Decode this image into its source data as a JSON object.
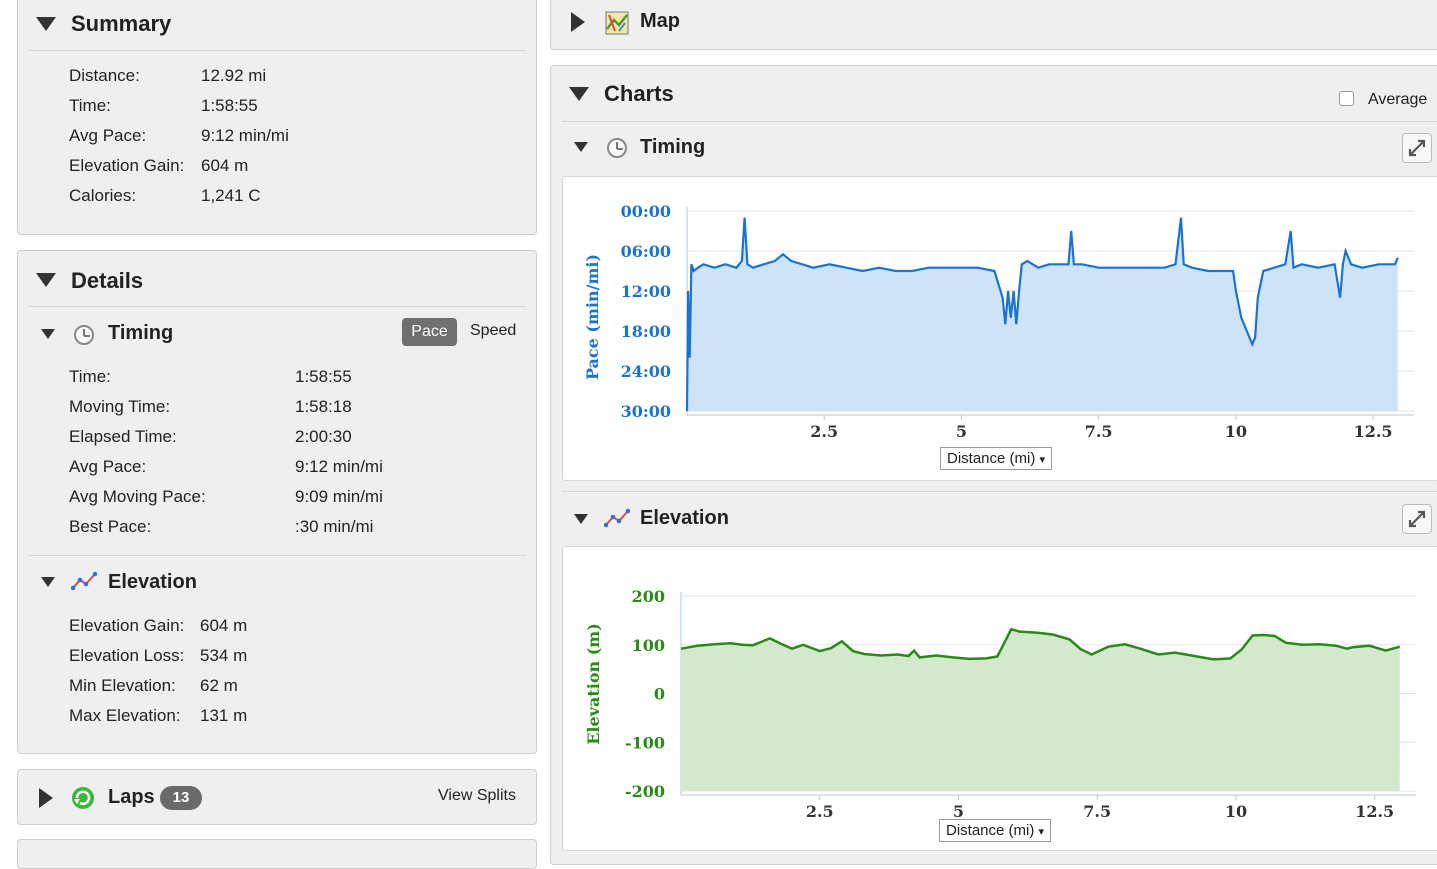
{
  "summary": {
    "title": "Summary",
    "rows": [
      {
        "label": "Distance:",
        "value": "12.92 mi"
      },
      {
        "label": "Time:",
        "value": "1:58:55"
      },
      {
        "label": "Avg Pace:",
        "value": "9:12 min/mi"
      },
      {
        "label": "Elevation Gain:",
        "value": "604 m"
      },
      {
        "label": "Calories:",
        "value": "1,241 C"
      }
    ]
  },
  "details": {
    "title": "Details",
    "timing": {
      "title": "Timing",
      "toggle": {
        "pace": "Pace",
        "speed": "Speed",
        "selected": "Pace"
      },
      "rows": [
        {
          "label": "Time:",
          "value": "1:58:55"
        },
        {
          "label": "Moving Time:",
          "value": "1:58:18"
        },
        {
          "label": "Elapsed Time:",
          "value": "2:00:30"
        },
        {
          "label": "Avg Pace:",
          "value": "9:12 min/mi"
        },
        {
          "label": "Avg Moving Pace:",
          "value": "9:09 min/mi"
        },
        {
          "label": "Best Pace:",
          "value": ":30 min/mi"
        }
      ]
    },
    "elevation": {
      "title": "Elevation",
      "rows": [
        {
          "label": "Elevation Gain:",
          "value": "604 m"
        },
        {
          "label": "Elevation Loss:",
          "value": "534 m"
        },
        {
          "label": "Min Elevation:",
          "value": "62 m"
        },
        {
          "label": "Max Elevation:",
          "value": "131 m"
        }
      ]
    }
  },
  "laps": {
    "title": "Laps",
    "count": "13",
    "view_splits": "View Splits"
  },
  "map": {
    "title": "Map"
  },
  "charts": {
    "title": "Charts",
    "average_label": "Average",
    "average_checked": false,
    "timing_title": "Timing",
    "elevation_title": "Elevation",
    "x_dropdown": "Distance (mi)",
    "dropdown_arrow": "▾"
  },
  "colors": {
    "pace_line": "#1a73d0",
    "pace_fill": "#cfe3f7",
    "elev_line": "#2a8a17",
    "elev_fill": "#d3e8cc"
  },
  "chart_data": [
    {
      "type": "area",
      "title": "",
      "ylabel": "Pace (min/mi)",
      "xlabel": "Distance (mi)",
      "x_ticks": [
        "2.5",
        "5",
        "7.5",
        "10",
        "12.5"
      ],
      "y_ticks": [
        "00:00",
        "06:00",
        "12:00",
        "18:00",
        "24:00",
        "30:00"
      ],
      "ylim": [
        0,
        30
      ],
      "xlim": [
        0,
        13.1
      ],
      "y_inverted": true,
      "series": [
        {
          "x": [
            0,
            0.02,
            0.05,
            0.08,
            0.12,
            0.2,
            0.3,
            0.5,
            0.7,
            0.9,
            1.0,
            1.05,
            1.1,
            1.2,
            1.4,
            1.6,
            1.75,
            1.9,
            2.1,
            2.3,
            2.6,
            2.9,
            3.2,
            3.5,
            3.8,
            4.1,
            4.4,
            4.7,
            5.0,
            5.3,
            5.6,
            5.75,
            5.8,
            5.85,
            5.9,
            5.95,
            6.0,
            6.05,
            6.1,
            6.2,
            6.4,
            6.6,
            6.8,
            6.95,
            7.0,
            7.05,
            7.2,
            7.5,
            7.8,
            8.1,
            8.4,
            8.7,
            8.9,
            9.0,
            9.05,
            9.2,
            9.5,
            9.8,
            9.95,
            10.0,
            10.05,
            10.1,
            10.2,
            10.3,
            10.35,
            10.4,
            10.5,
            10.7,
            10.9,
            11.0,
            11.05,
            11.2,
            11.5,
            11.8,
            11.9,
            11.95,
            12.0,
            12.1,
            12.3,
            12.6,
            12.9,
            12.95
          ],
          "y": [
            30,
            12,
            22,
            8,
            9,
            8.5,
            8,
            8.5,
            8,
            8.5,
            7.5,
            1,
            8,
            8.5,
            8,
            7.5,
            6.5,
            7.5,
            8,
            8.5,
            8,
            8.5,
            9,
            8.5,
            9,
            9,
            8.5,
            8.5,
            8.5,
            8.5,
            9,
            13,
            17,
            12,
            16,
            12,
            17,
            12,
            8,
            7.5,
            8.5,
            8,
            8,
            8,
            3,
            8,
            8,
            8.5,
            8.5,
            8.5,
            8.5,
            8.5,
            8,
            1,
            8,
            8.5,
            9,
            9,
            9,
            12,
            14,
            16,
            18,
            20,
            19,
            13,
            9,
            8.5,
            8,
            3,
            8.5,
            8,
            8.5,
            8,
            13,
            8,
            6,
            8,
            8.5,
            8,
            8,
            7
          ]
        }
      ]
    },
    {
      "type": "area",
      "title": "",
      "ylabel": "Elevation (m)",
      "xlabel": "Distance (mi)",
      "x_ticks": [
        "2.5",
        "5",
        "7.5",
        "10",
        "12.5"
      ],
      "y_ticks": [
        "200",
        "100",
        "0",
        "-100",
        "-200"
      ],
      "ylim": [
        -200,
        200
      ],
      "xlim": [
        0,
        13.1
      ],
      "series": [
        {
          "x": [
            0,
            0.3,
            0.6,
            0.9,
            1.1,
            1.3,
            1.6,
            1.8,
            2.0,
            2.2,
            2.5,
            2.7,
            2.9,
            3.1,
            3.3,
            3.6,
            3.9,
            4.1,
            4.2,
            4.3,
            4.6,
            4.9,
            5.2,
            5.5,
            5.7,
            5.8,
            5.95,
            6.1,
            6.4,
            6.7,
            7.0,
            7.2,
            7.4,
            7.7,
            8.0,
            8.3,
            8.6,
            8.9,
            9.1,
            9.3,
            9.6,
            9.9,
            10.1,
            10.3,
            10.5,
            10.7,
            10.9,
            11.2,
            11.5,
            11.8,
            12.0,
            12.1,
            12.4,
            12.7,
            12.95
          ],
          "y": [
            92,
            98,
            101,
            103,
            100,
            99,
            113,
            102,
            92,
            100,
            87,
            93,
            107,
            87,
            81,
            78,
            80,
            77,
            88,
            74,
            78,
            74,
            71,
            72,
            76,
            98,
            132,
            127,
            125,
            121,
            111,
            91,
            80,
            96,
            101,
            91,
            80,
            84,
            80,
            76,
            70,
            72,
            90,
            119,
            120,
            118,
            104,
            100,
            101,
            98,
            92,
            95,
            98,
            88,
            96
          ]
        }
      ]
    }
  ]
}
